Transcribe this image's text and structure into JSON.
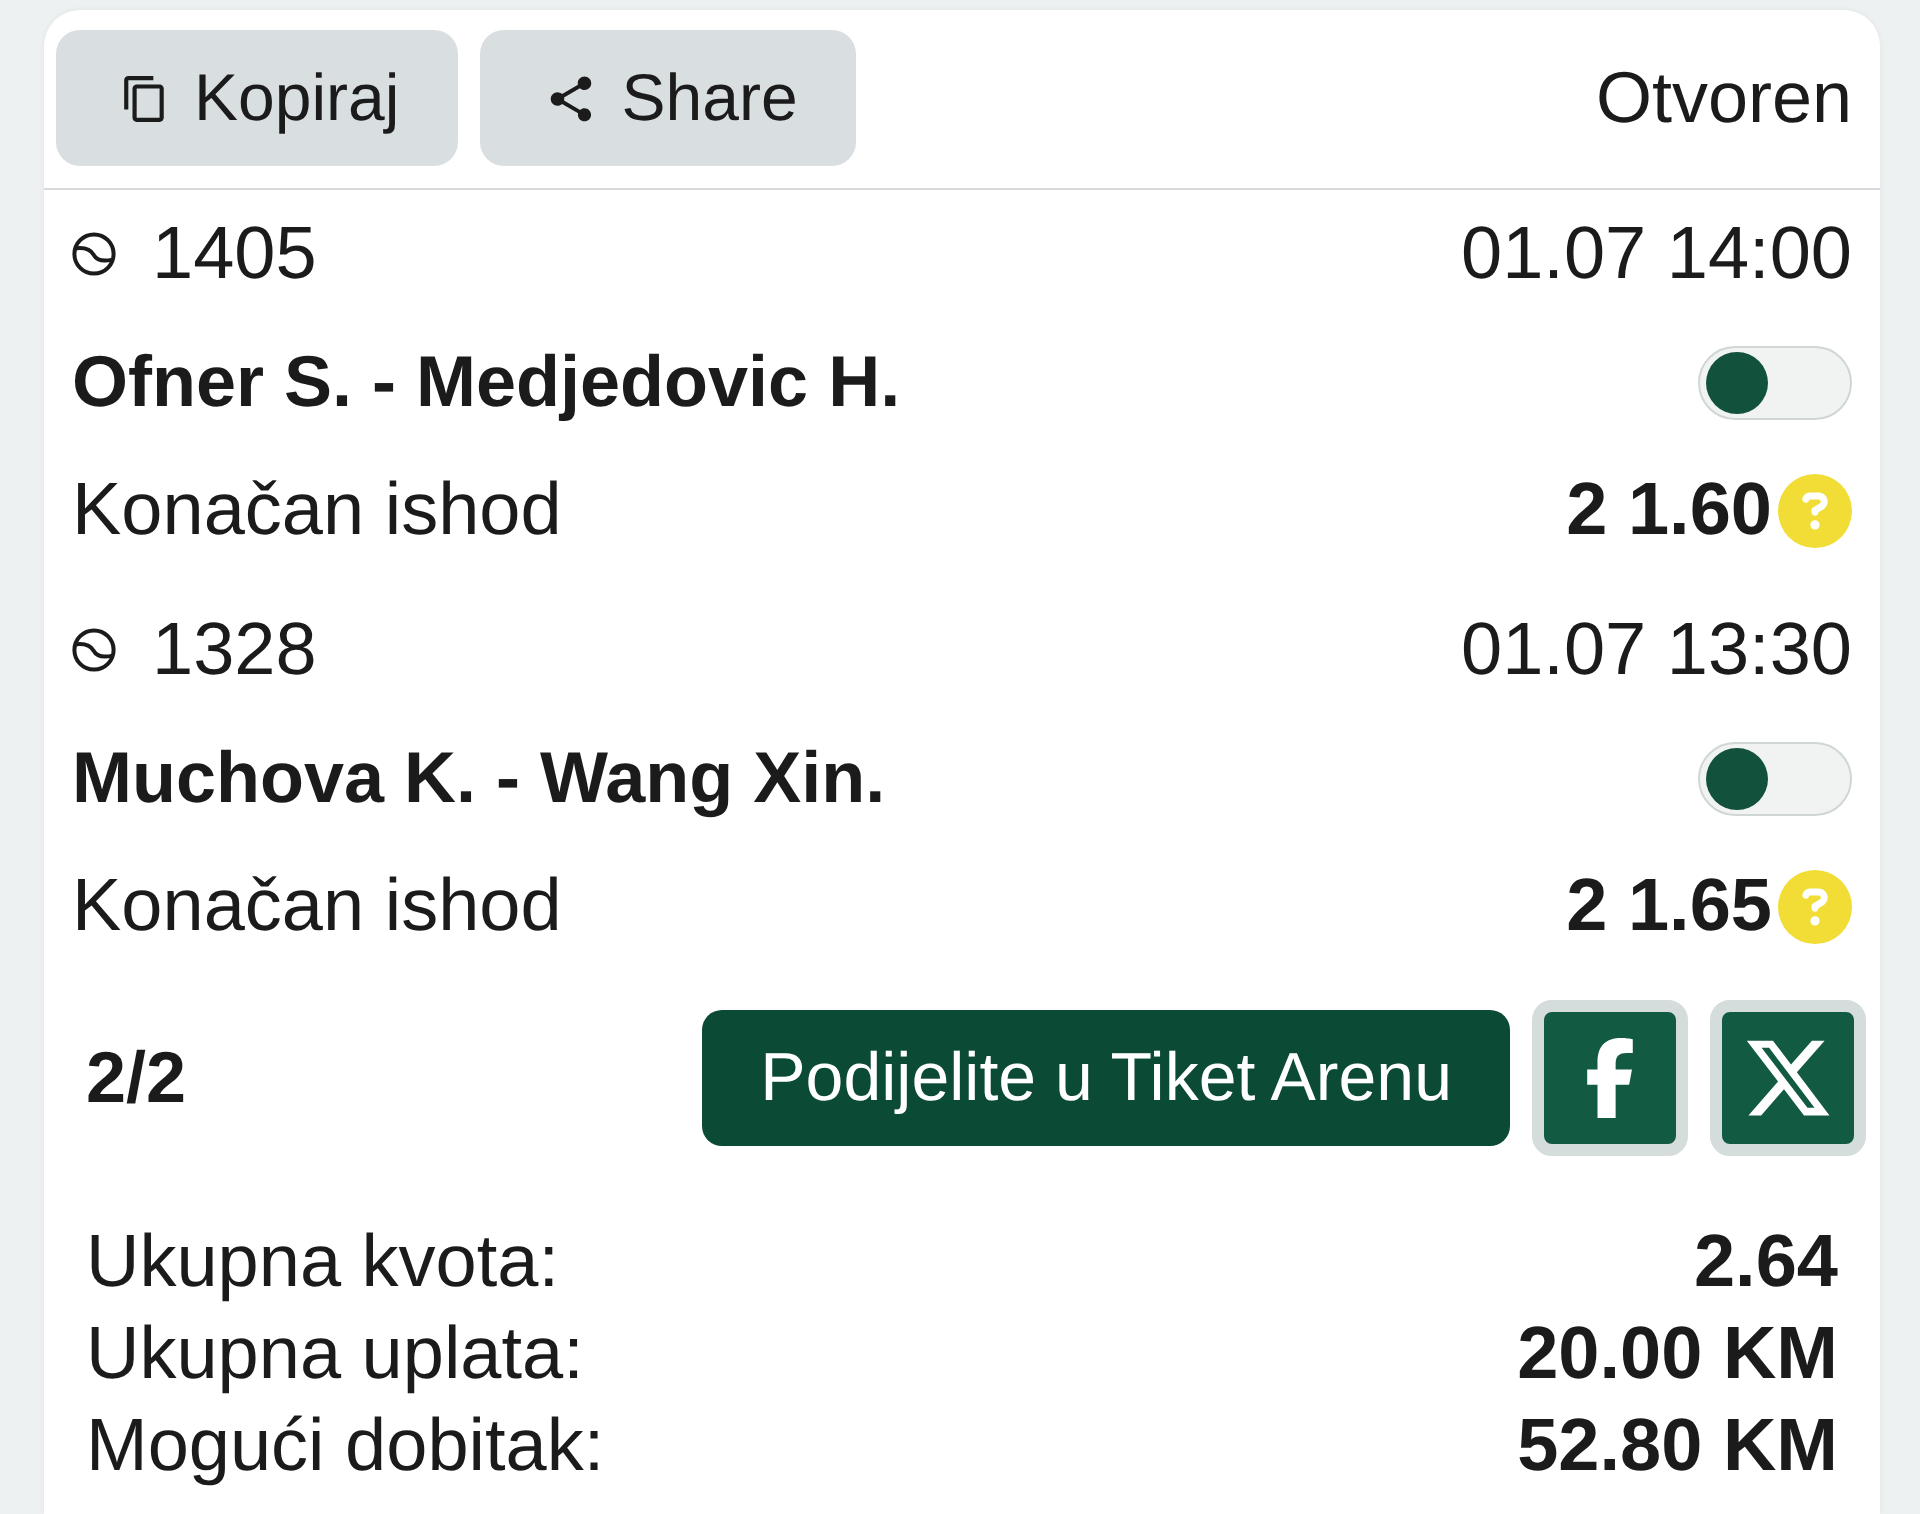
{
  "header": {
    "buttons": [
      {
        "kind": "copy",
        "label": "Kopiraj"
      },
      {
        "kind": "share",
        "label": "Share"
      }
    ],
    "status": "Otvoren"
  },
  "matches": [
    {
      "code": "1405",
      "datetime": "01.07 14:00",
      "teams": "Ofner S. - Medjedovic H.",
      "toggle_on": false,
      "market": "Konačan ishod",
      "selection": "2 1.60"
    },
    {
      "code": "1328",
      "datetime": "01.07 13:30",
      "teams": "Muchova K. - Wang Xin.",
      "toggle_on": false,
      "market": "Konačan ishod",
      "selection": "2 1.65"
    }
  ],
  "share_row": {
    "page": "2/2",
    "share_button": "Podijelite u Tiket Arenu",
    "social": [
      {
        "kind": "facebook"
      },
      {
        "kind": "x"
      }
    ]
  },
  "summary": [
    {
      "label": "Ukupna kvota:",
      "value": "2.64"
    },
    {
      "label": "Ukupna uplata:",
      "value": "20.00 KM"
    },
    {
      "label": "Mogući dobitak:",
      "value": "52.80 KM"
    }
  ]
}
